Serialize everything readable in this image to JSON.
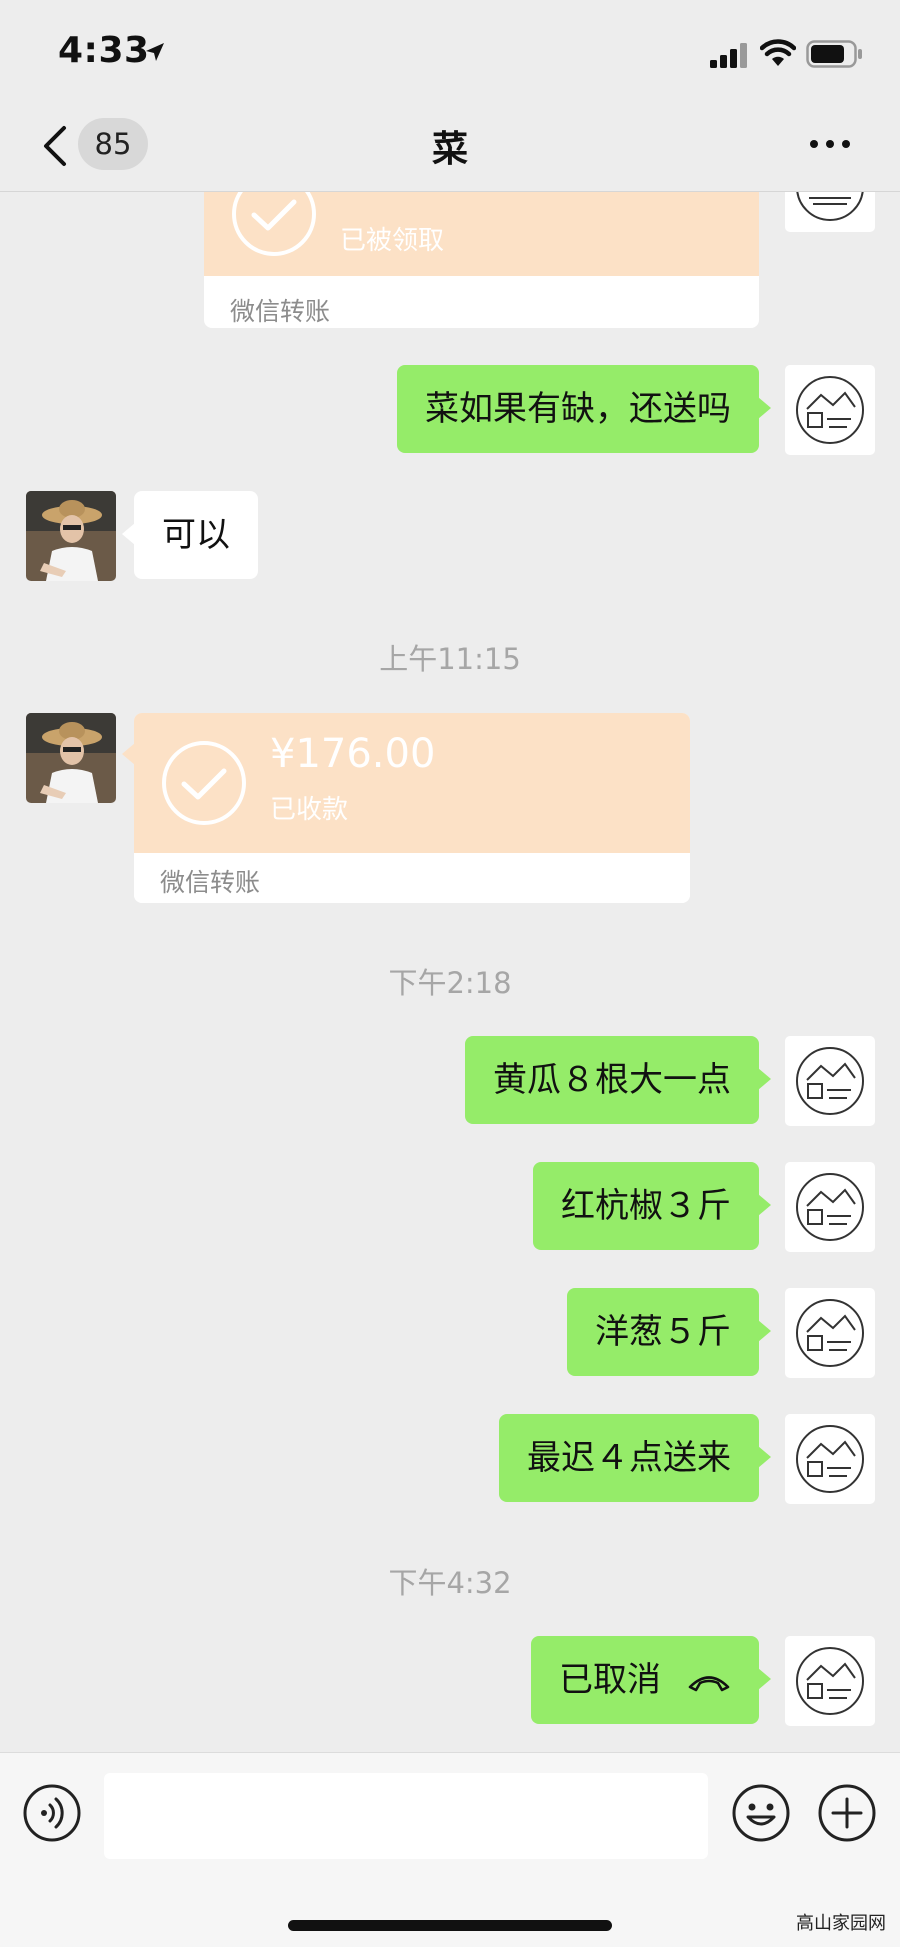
{
  "status_bar": {
    "time": "4:33",
    "icons": [
      "location-arrow-icon",
      "signal-icon",
      "wifi-icon",
      "battery-icon"
    ]
  },
  "nav": {
    "unread_count": "85",
    "title": "菜",
    "icons": [
      "back-chevron-icon",
      "more-icon"
    ]
  },
  "messages": {
    "transfer_top": {
      "status": "已被领取",
      "label": "微信转账"
    },
    "out_1": "菜如果有缺，还送吗",
    "in_1": "可以",
    "time_1": "上午11:15",
    "transfer_in": {
      "amount": "¥176.00",
      "status": "已收款",
      "label": "微信转账"
    },
    "time_2": "下午2:18",
    "out_2": "黄瓜８根大一点",
    "out_3": "红杭椒３斤",
    "out_4": "洋葱５斤",
    "out_5": "最迟４点送来",
    "time_3": "下午4:32",
    "call_status": "已取消"
  },
  "input": {
    "value": "",
    "icons": [
      "voice-icon",
      "emoji-icon",
      "plus-icon"
    ]
  },
  "watermark": "高山家园网",
  "colors": {
    "background": "#ededed",
    "outgoing_bubble": "#95ec69",
    "incoming_bubble": "#ffffff",
    "transfer_card": "#fce1c6",
    "timestamp": "#a6a6a6"
  }
}
